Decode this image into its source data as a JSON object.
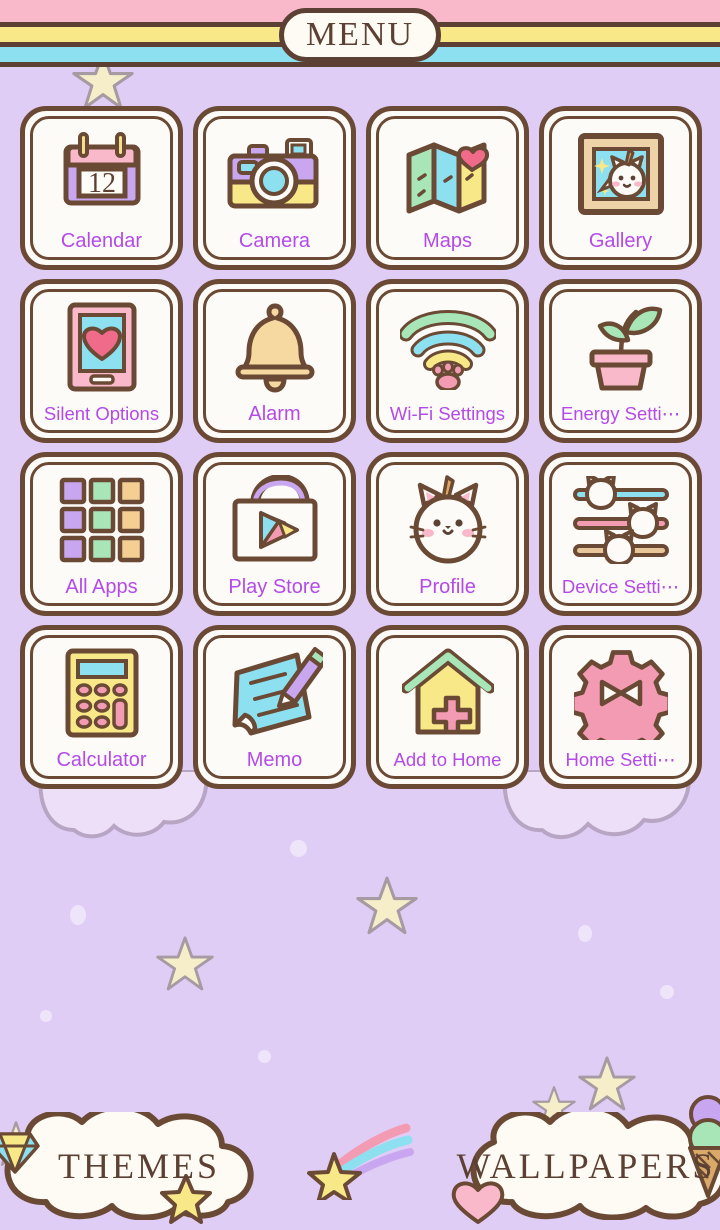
{
  "header": {
    "title": "MENU",
    "stripe_colors": [
      "#f9b9ca",
      "#f8e888",
      "#8ce0f0"
    ],
    "outline_color": "#5c4033"
  },
  "theme": {
    "background": "#e0cdf5",
    "tile_background": "#fdfbf7",
    "tile_border": "#6b4a35",
    "label_color": "#b44ae8",
    "star_fill": "#f5eec9",
    "cloud_fill": "#fdfbf4"
  },
  "grid": {
    "columns": 4,
    "rows": 4,
    "items": [
      {
        "label": "Calendar",
        "icon": "calendar-icon",
        "date": "12"
      },
      {
        "label": "Camera",
        "icon": "camera-icon"
      },
      {
        "label": "Maps",
        "icon": "maps-icon"
      },
      {
        "label": "Gallery",
        "icon": "gallery-icon"
      },
      {
        "label": "Silent Options",
        "icon": "silent-options-icon"
      },
      {
        "label": "Alarm",
        "icon": "alarm-bell-icon"
      },
      {
        "label": "Wi-Fi Settings",
        "icon": "wifi-paw-icon"
      },
      {
        "label": "Energy Setti⋯",
        "icon": "plant-icon"
      },
      {
        "label": "All Apps",
        "icon": "all-apps-grid-icon"
      },
      {
        "label": "Play Store",
        "icon": "play-store-icon"
      },
      {
        "label": "Profile",
        "icon": "unicorn-cat-icon"
      },
      {
        "label": "Device Setti⋯",
        "icon": "sliders-cat-icon"
      },
      {
        "label": "Calculator",
        "icon": "calculator-icon"
      },
      {
        "label": "Memo",
        "icon": "memo-pencil-icon"
      },
      {
        "label": "Add to Home",
        "icon": "house-plus-icon"
      },
      {
        "label": "Home Setti⋯",
        "icon": "gear-bow-icon"
      }
    ]
  },
  "bottom_bar": {
    "themes_label": "THEMES",
    "wallpapers_label": "WALLPAPERS",
    "decorations": [
      "diamond-icon",
      "star-icon",
      "shooting-star-icon",
      "heart-icon",
      "ice-cream-icon"
    ]
  }
}
